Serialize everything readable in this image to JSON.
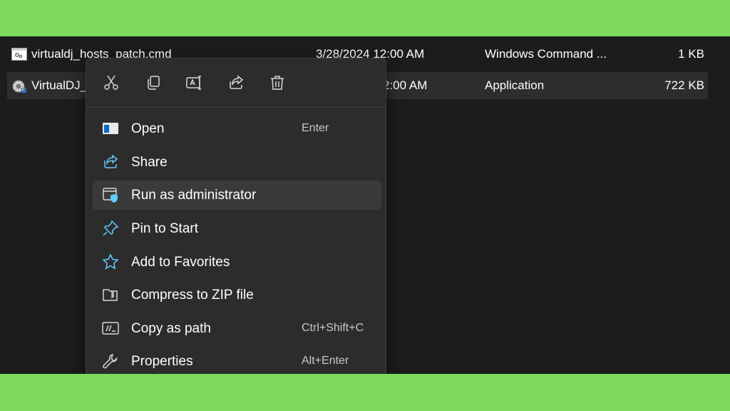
{
  "files": [
    {
      "name": "virtualdj_hosts_patch.cmd",
      "date": "3/28/2024 12:00 AM",
      "type": "Windows Command ...",
      "size": "1 KB",
      "icon": "cmd-file-icon"
    },
    {
      "name": "VirtualDJ_",
      "date": "2:00 AM",
      "type": "Application",
      "size": "722 KB",
      "icon": "virtualdj-app-icon"
    }
  ],
  "quick_actions": [
    {
      "name": "cut-icon"
    },
    {
      "name": "copy-icon"
    },
    {
      "name": "rename-icon"
    },
    {
      "name": "share-icon"
    },
    {
      "name": "delete-icon"
    }
  ],
  "menu": {
    "items": [
      {
        "label": "Open",
        "shortcut": "Enter",
        "icon": "open-window-icon"
      },
      {
        "label": "Share",
        "shortcut": "",
        "icon": "share-icon"
      },
      {
        "label": "Run as administrator",
        "shortcut": "",
        "icon": "shield-icon"
      },
      {
        "label": "Pin to Start",
        "shortcut": "",
        "icon": "pin-icon"
      },
      {
        "label": "Add to Favorites",
        "shortcut": "",
        "icon": "star-icon"
      },
      {
        "label": "Compress to ZIP file",
        "shortcut": "",
        "icon": "zip-folder-icon"
      },
      {
        "label": "Copy as path",
        "shortcut": "Ctrl+Shift+C",
        "icon": "copy-path-icon"
      },
      {
        "label": "Properties",
        "shortcut": "Alt+Enter",
        "icon": "wrench-icon"
      }
    ]
  },
  "colors": {
    "background": "#7dd95a",
    "screen": "#1c1c1c",
    "menu": "#2c2c2c",
    "accent": "#60cdff"
  }
}
